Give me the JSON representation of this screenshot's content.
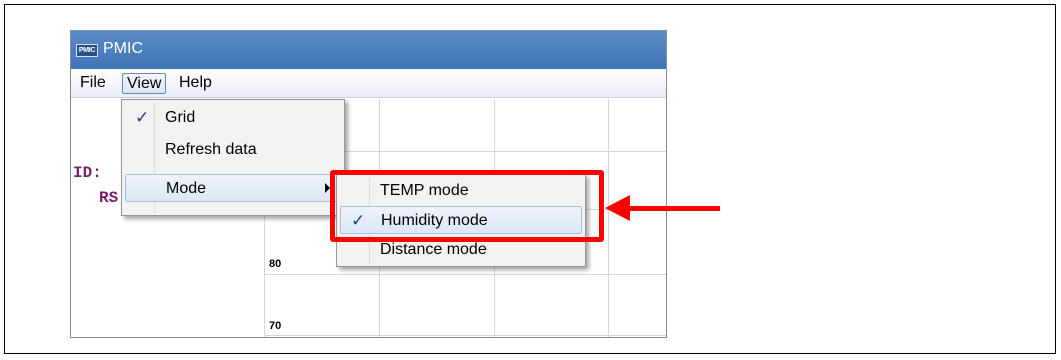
{
  "window": {
    "app_logo_text": "PMIC",
    "title": "PMIC"
  },
  "menubar": {
    "items": [
      "File",
      "View",
      "Help"
    ],
    "active": "View"
  },
  "content": {
    "code_lines": [
      "ID:",
      "RS"
    ],
    "y_ticks": [
      "80",
      "70"
    ]
  },
  "view_menu": {
    "items": [
      {
        "label": "Grid",
        "checked": true
      },
      {
        "label": "Refresh data",
        "checked": false
      },
      {
        "label": "Mode",
        "checked": false,
        "has_submenu": true
      }
    ]
  },
  "mode_menu": {
    "items": [
      {
        "label": "TEMP mode",
        "checked": false
      },
      {
        "label": "Humidity mode",
        "checked": true
      },
      {
        "label": "Distance mode",
        "checked": false
      }
    ]
  },
  "annotation": {
    "color": "#ff0000",
    "check_glyph": "✓"
  }
}
